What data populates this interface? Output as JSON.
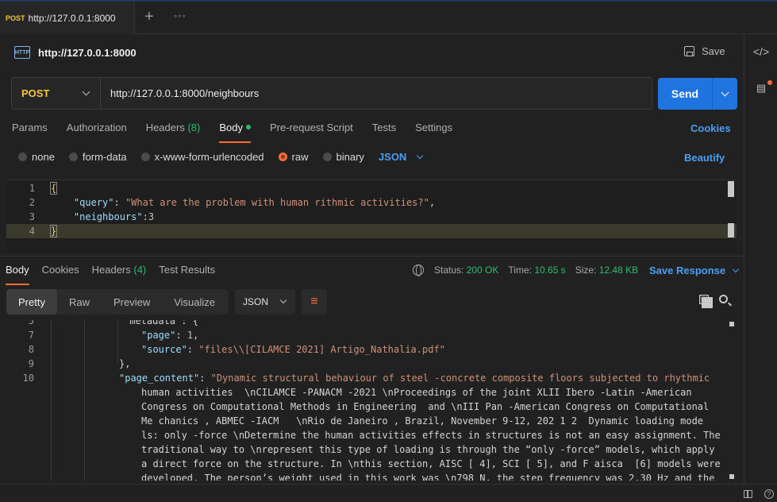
{
  "tab": {
    "method": "POST",
    "name": "http://127.0.0.1:8000"
  },
  "request": {
    "title": "http://127.0.0.1:8000",
    "save_label": "Save",
    "method": "POST",
    "url": "http://127.0.0.1:8000/neighbours",
    "send_label": "Send"
  },
  "request_tabs": {
    "params": "Params",
    "authorization": "Authorization",
    "headers": "Headers",
    "headers_count": "(8)",
    "body": "Body",
    "prerequest": "Pre-request Script",
    "tests": "Tests",
    "settings": "Settings",
    "cookies": "Cookies"
  },
  "body_types": {
    "none": "none",
    "form_data": "form-data",
    "urlencoded": "x-www-form-urlencoded",
    "raw": "raw",
    "binary": "binary",
    "format": "JSON",
    "beautify": "Beautify"
  },
  "request_body": {
    "lines": [
      "1",
      "2",
      "3",
      "4"
    ],
    "open_brace": "{",
    "close_brace": "}",
    "k_query": "\"query\"",
    "v_query": "\"What are the problem with human rithmic activities?\"",
    "k_neighbours": "\"neighbours\"",
    "v_neighbours": "3"
  },
  "response_tabs": {
    "body": "Body",
    "cookies": "Cookies",
    "headers": "Headers",
    "headers_count": "(4)",
    "test_results": "Test Results"
  },
  "response_meta": {
    "status_label": "Status:",
    "status": "200 OK",
    "time_label": "Time:",
    "time": "10.65 s",
    "size_label": "Size:",
    "size": "12.48 KB",
    "save_response": "Save Response"
  },
  "view_modes": {
    "pretty": "Pretty",
    "raw": "Raw",
    "preview": "Preview",
    "visualize": "Visualize",
    "format": "JSON"
  },
  "response_body": {
    "l6": "5",
    "l6_text": "\"metadata\": {",
    "l7": "7",
    "l7_key": "\"page\"",
    "l7_val": "1",
    "l8": "8",
    "l8_key": "\"source\"",
    "l8_val": "\"files\\\\[CILAMCE 2021] Artigo_Nathalia.pdf\"",
    "l9": "9",
    "l9_text": "},",
    "l10": "10",
    "l10_key": "\"page_content\"",
    "content_lines": [
      "\"Dynamic structural behaviour of steel -concrete composite floors subjected to rhythmic",
      "human activities  \\nCILAMCE -PANACM -2021 \\nProceedings of the joint XLII Ibero -Latin -American",
      "Congress on Computational Methods in Engineering  and \\nIII Pan -American Congress on Computational",
      "Me chanics , ABMEC -IACM   \\nRio de Janeiro , Brazil, November 9-12, 202 1 2  Dynamic loading mode",
      "ls: only -force \\nDetermine the human activities effects in structures is not an easy assignment. The",
      "traditional way to \\nrepresent this type of loading is through the “only -force” models, which apply",
      "a direct force on the structure. In \\nthis section, AISC [ 4], SCI [ 5], and F aisca  [6] models were",
      "developed. The person’s weight used in this work was \\n798 N, the step frequency was 2.30 Hz and the"
    ]
  }
}
